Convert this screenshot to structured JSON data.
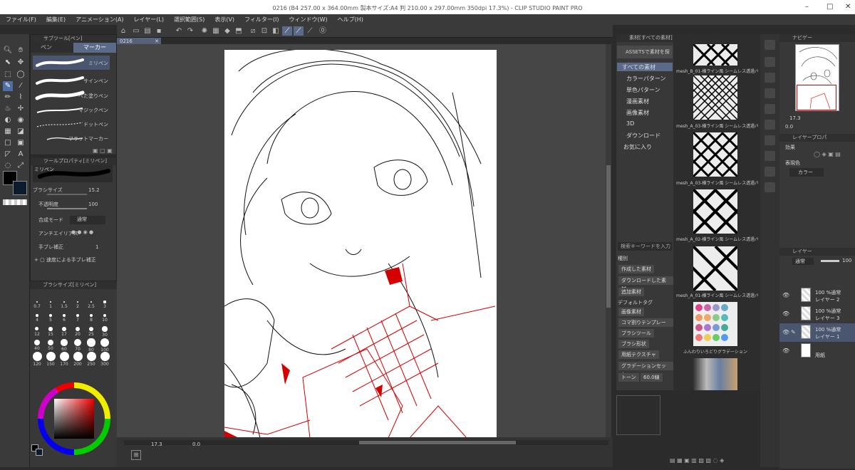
{
  "window": {
    "title": "0216 (B4 257.00 x 364.00mm 製本サイズ:A4 判 210.00 x 297.00mm 350dpi 17.3%) - CLIP STUDIO PAINT PRO"
  },
  "menu": [
    "ファイル(F)",
    "編集(E)",
    "アニメーション(A)",
    "レイヤー(L)",
    "選択範囲(S)",
    "表示(V)",
    "フィルター(I)",
    "ウィンドウ(W)",
    "ヘルプ(H)"
  ],
  "doc_tab": "0216",
  "subtool": {
    "header": "サブツール[ペン]",
    "tabs": [
      "ペン",
      "マーカー"
    ],
    "brushes": [
      "ミリペン",
      "サインペン",
      "べた塗りペン",
      "マジックペン",
      "ドットペン",
      "フラットマーカー"
    ],
    "active_brush": "ミリペン"
  },
  "tool_property": {
    "header": "ツールプロパティ[ミリペン]",
    "brush_name": "ミリペン",
    "brush_size_label": "ブラシサイズ",
    "brush_size": "15.2",
    "opacity_label": "不透明度",
    "opacity": "100",
    "blend_label": "合成モード",
    "blend_value": "通常",
    "antialias_label": "アンチエイリアス",
    "stabilize_label": "手ブレ補正",
    "stabilize_value": "1",
    "speed_stabilize_label": "速度による手ブレ補正"
  },
  "brush_size_panel": {
    "header": "ブラシサイズ[ミリペン]",
    "sizes": [
      "0.7",
      "1",
      "1.5",
      "2",
      "2.5",
      "3",
      "4",
      "5",
      "6",
      "7",
      "8",
      "10",
      "12",
      "15",
      "17",
      "20",
      "25",
      "30",
      "40",
      "50",
      "60",
      "70",
      "80",
      "100",
      "120",
      "150",
      "170",
      "200",
      "250",
      "300"
    ]
  },
  "status": {
    "zoom": "17.3",
    "angle": "0.0"
  },
  "material": {
    "header": "素材[すべての素材]",
    "assets_button": "ASSETSで素材を探す",
    "tree": [
      "すべての素材",
      "カラーパターン",
      "単色パターン",
      "漫画素材",
      "画像素材",
      "3D",
      "ダウンロード",
      "お気に入り"
    ],
    "search_placeholder": "検索キーワードを入力",
    "index_label": "種別",
    "index_items": [
      "作成した素材",
      "ダウンロードした素材",
      "追加素材"
    ],
    "default_tag_label": "デフォルトタグ",
    "default_tags": [
      "画像素材",
      "コマ割りテンプレート",
      "ブラシツール",
      "ブラシ形状",
      "用紙テクスチャ",
      "グラデーションセット"
    ],
    "tone_tags": [
      "トーン",
      "60.0線"
    ],
    "items": [
      "mesh_B_01-横ライン風 シームレス透過パターン",
      "mesh_A_03-横ライン風 シームレス透過パターン",
      "mesh_A_03-横ライン風 シームレス透過パターン",
      "mesh_A_02-横ライン風 シームレス透過パターン",
      "mesh_A_01-横ライン風 シームレス透過パターン",
      "ふんわりいろどりグラデーション"
    ]
  },
  "navigator": {
    "header": "ナビゲー",
    "zoom": "17.3",
    "angle": "0.0"
  },
  "layer_property": {
    "header": "レイヤープロパ",
    "effect_label": "効果",
    "expression_label": "表現色",
    "expression_value": "カラー"
  },
  "layers_panel": {
    "header": "レイヤー",
    "blend": "通常",
    "opacity": "100",
    "layers": [
      {
        "mode": "100 %通常",
        "name": "レイヤー 2"
      },
      {
        "mode": "100 %通常",
        "name": "レイヤー 3"
      },
      {
        "mode": "100 %通常",
        "name": "レイヤー 1"
      },
      {
        "mode": "",
        "name": "用紙"
      }
    ]
  },
  "colors": {
    "accent": "#5a6a88",
    "line_red": "#d40000",
    "main": "#000000",
    "sub": "#0b1c2e"
  }
}
